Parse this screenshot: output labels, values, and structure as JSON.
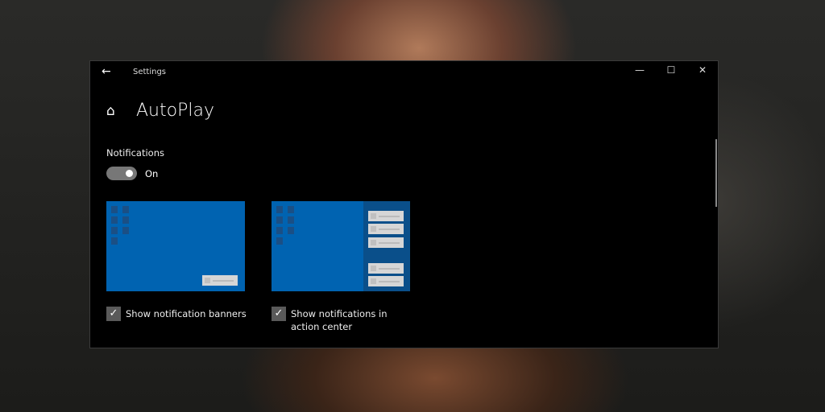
{
  "window": {
    "title": "Settings",
    "back_icon": "arrow-left",
    "controls": [
      "minimize",
      "maximize",
      "close"
    ]
  },
  "page": {
    "title": "AutoPlay"
  },
  "notifications": {
    "label": "Notifications",
    "toggle_state": "On",
    "toggle_on": true
  },
  "options": [
    {
      "label": "Show notification banners",
      "checked": true
    },
    {
      "label": "Show notifications in action center",
      "checked": true
    }
  ],
  "colors": {
    "preview_blue": "#0063b1",
    "toggle": "#777777"
  }
}
